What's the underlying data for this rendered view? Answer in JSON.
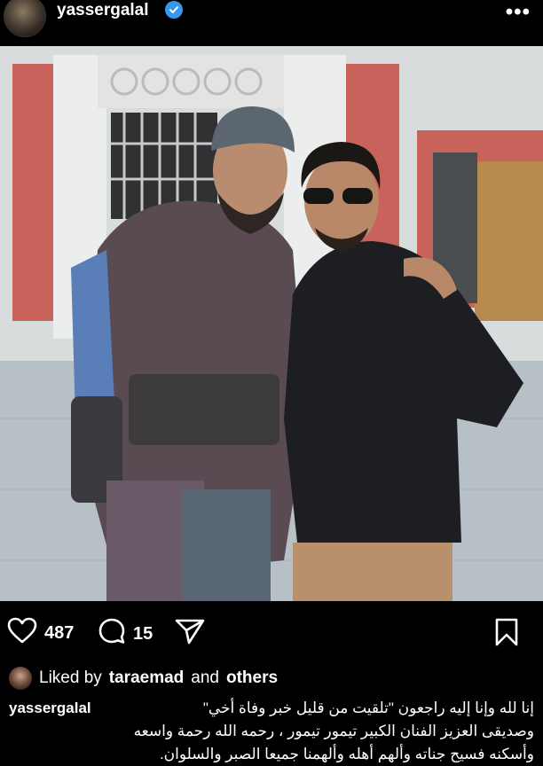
{
  "post": {
    "username": "yassergalal",
    "verified_icon": "verified-badge-icon",
    "more_icon": "more-options-icon",
    "media_alt": "Two men posing on a film set"
  },
  "actions": {
    "likes_count": "487",
    "comments_count": "15"
  },
  "liked_by": {
    "prefix": "Liked by",
    "user": "taraemad",
    "and": "and",
    "others": "others"
  },
  "caption": {
    "username": "yassergalal",
    "line1": "إنا لله وإنا إليه راجعون \"تلقيت من قليل خبر وفاة أخي\"",
    "line2": "وصديقى العزيز  الفنان الكبير تيمور تيمور ، رحمه الله رحمة واسعه",
    "line3": "وأسكنه فسيح جناته وألهم أهله وألهمنا جميعا الصبر والسلوان."
  },
  "colors": {
    "background": "#000000",
    "verified": "#3797f0",
    "text": "#ffffff"
  }
}
